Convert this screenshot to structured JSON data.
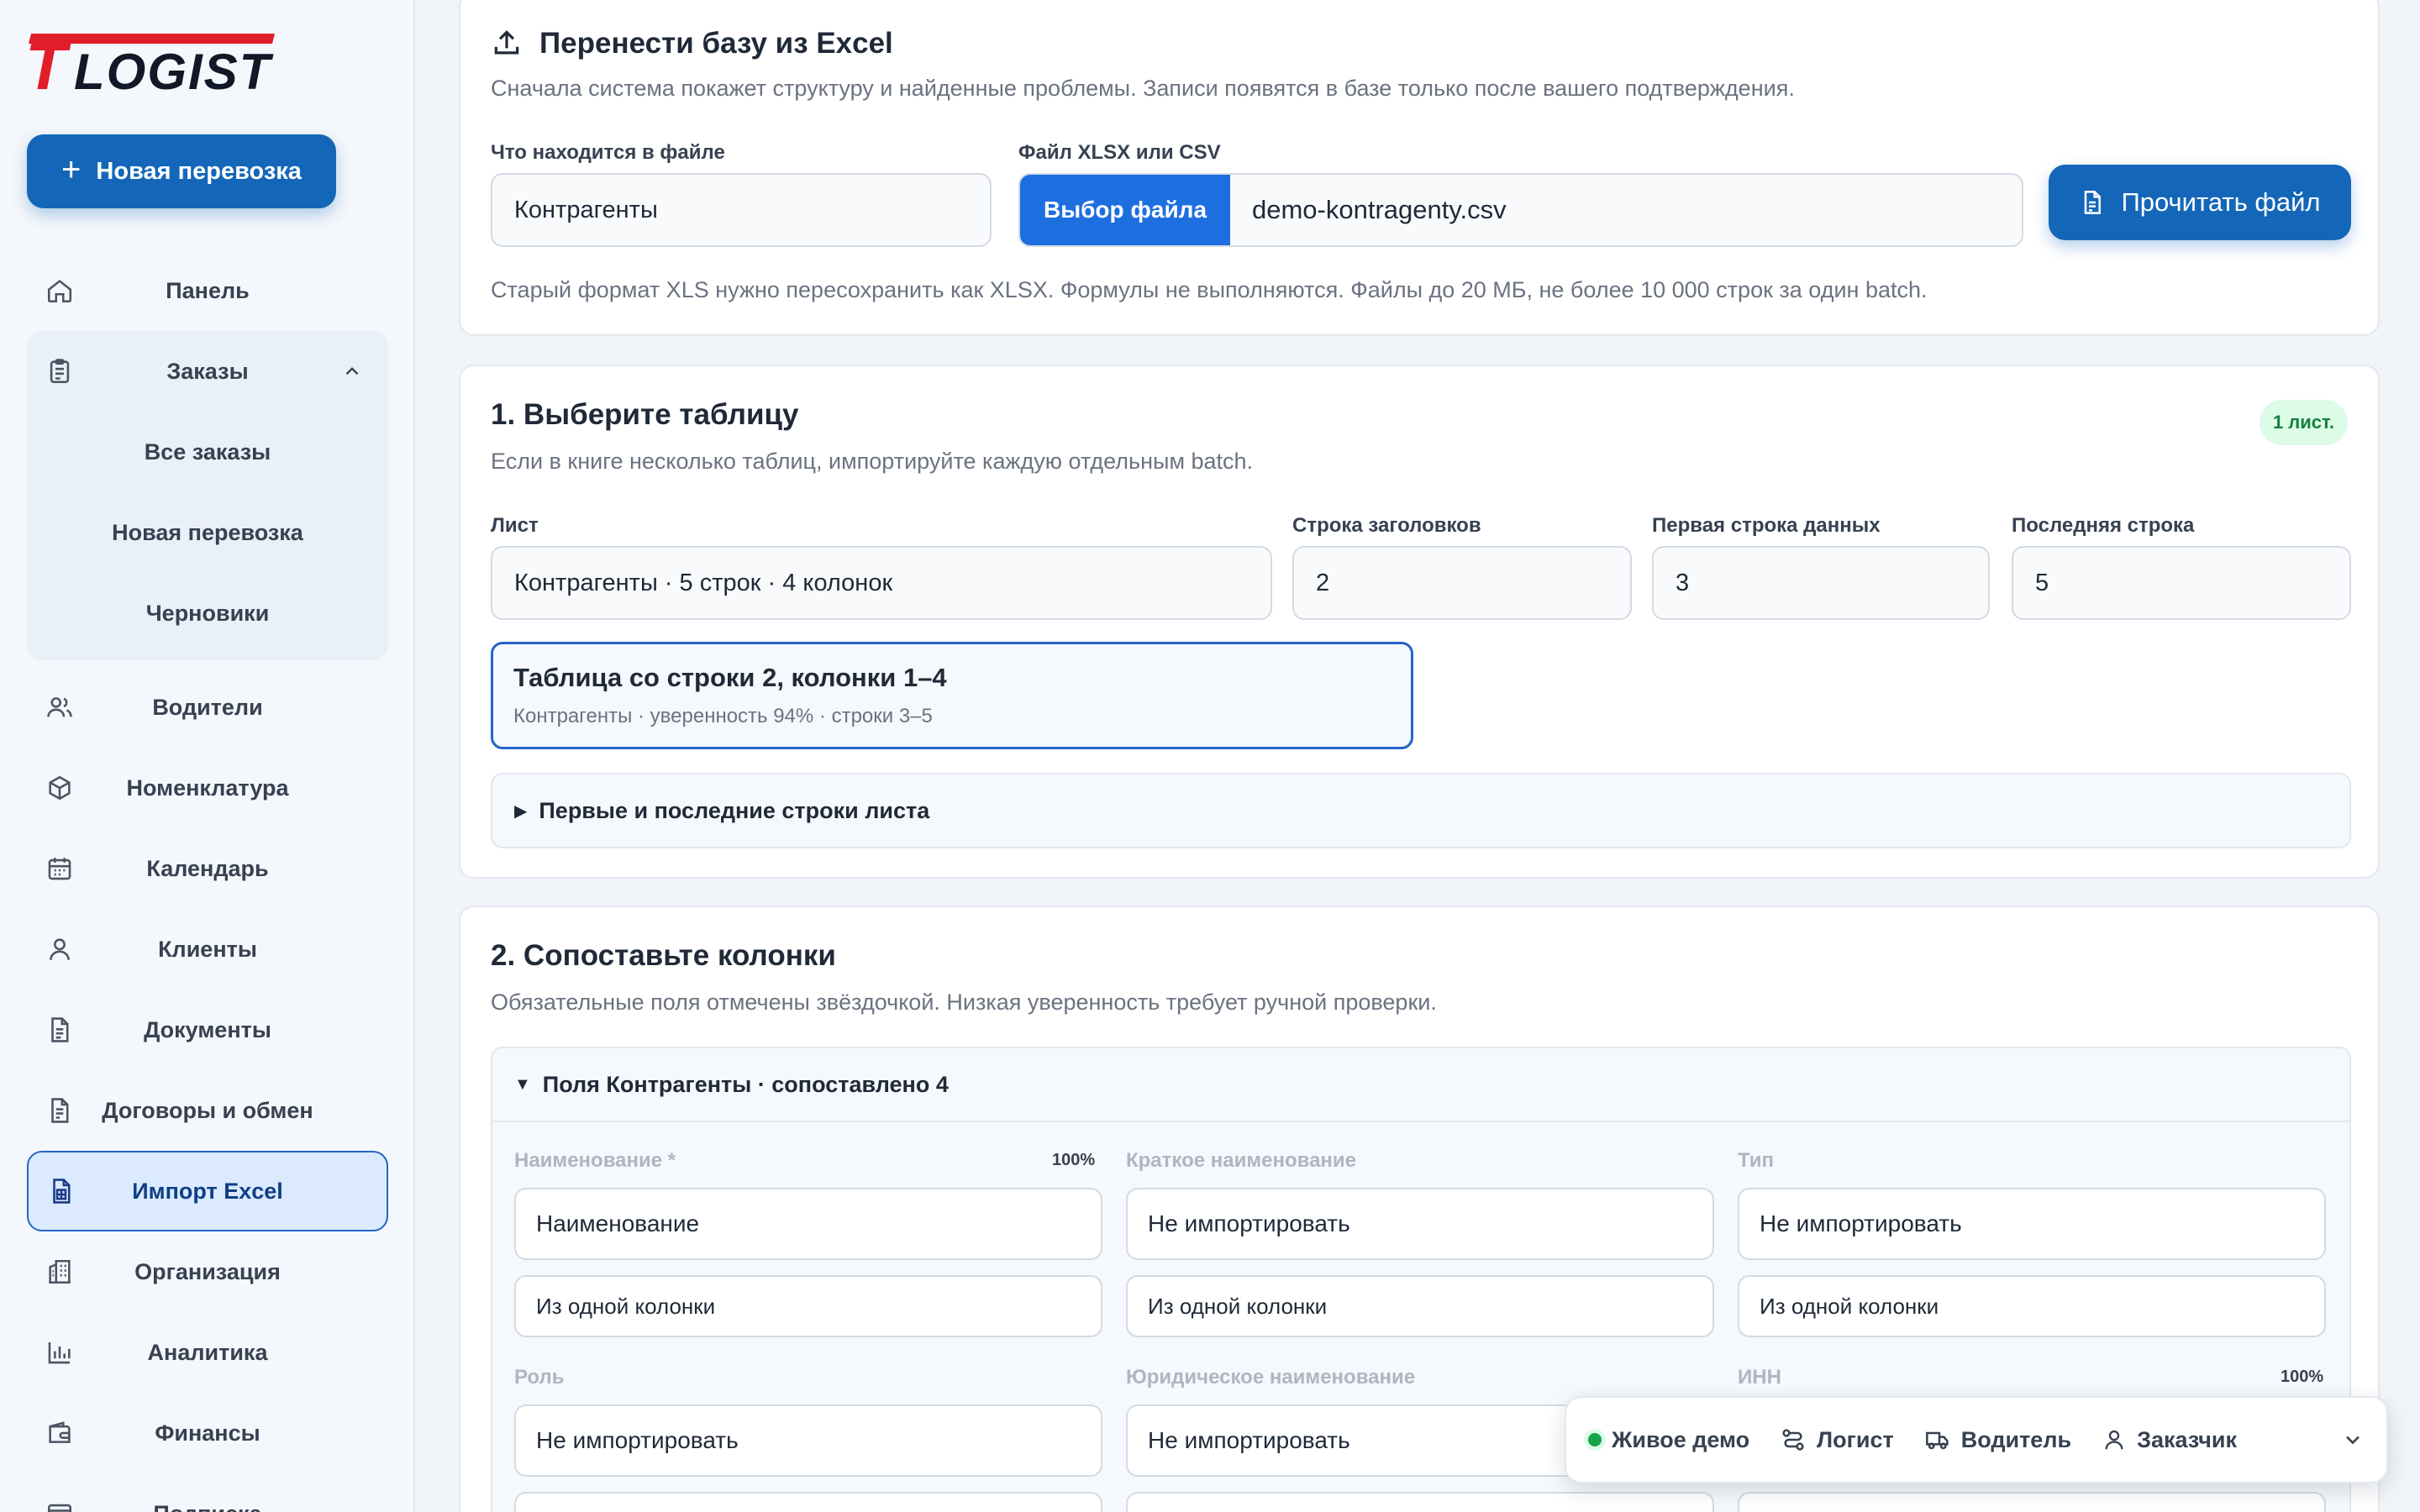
{
  "brand": {
    "logo_text": "TLOGIST",
    "accent": "#e11d2a"
  },
  "sidebar": {
    "new_button": "Новая перевозка",
    "items": [
      {
        "label": "Панель",
        "icon": "home-icon"
      },
      {
        "label": "Заказы",
        "icon": "clipboard-icon",
        "expanded": true,
        "children": [
          "Все заказы",
          "Новая перевозка",
          "Черновики"
        ]
      },
      {
        "label": "Водители",
        "icon": "users-icon"
      },
      {
        "label": "Номенклатура",
        "icon": "package-icon"
      },
      {
        "label": "Календарь",
        "icon": "calendar-icon"
      },
      {
        "label": "Клиенты",
        "icon": "user-icon"
      },
      {
        "label": "Документы",
        "icon": "document-icon"
      },
      {
        "label": "Договоры и обмен",
        "icon": "contract-icon"
      },
      {
        "label": "Импорт Excel",
        "icon": "spreadsheet-icon",
        "active": true
      },
      {
        "label": "Организация",
        "icon": "building-icon"
      },
      {
        "label": "Аналитика",
        "icon": "chart-icon"
      },
      {
        "label": "Финансы",
        "icon": "wallet-icon"
      },
      {
        "label": "Подписка",
        "icon": "card-icon"
      }
    ]
  },
  "upload": {
    "title": "Перенести базу из Excel",
    "subtitle": "Сначала система покажет структуру и найденные проблемы. Записи появятся в базе только после вашего подтверждения.",
    "content_label": "Что находится в файле",
    "content_value": "Контрагенты",
    "file_label": "Файл XLSX или CSV",
    "file_button": "Выбор файла",
    "file_name": "demo-kontragenty.csv",
    "read_button": "Прочитать файл",
    "hint": "Старый формат XLS нужно пересохранить как XLSX. Формулы не выполняются. Файлы до 20 МБ, не более 10 000 строк за один batch."
  },
  "step1": {
    "title": "1. Выберите таблицу",
    "subtitle": "Если в книге несколько таблиц, импортируйте каждую отдельным batch.",
    "badge": "1 лист.",
    "sheet_label": "Лист",
    "sheet_value": "Контрагенты · 5 строк · 4 колонок",
    "header_row_label": "Строка заголовков",
    "header_row_value": "2",
    "first_row_label": "Первая строка данных",
    "first_row_value": "3",
    "last_row_label": "Последняя строка",
    "last_row_value": "5",
    "table_title": "Таблица со строки 2, колонки 1–4",
    "table_sub": "Контрагенты · уверенность 94% · строки 3–5",
    "preview_toggle": "Первые и последние строки листа"
  },
  "step2": {
    "title": "2. Сопоставьте колонки",
    "subtitle": "Обязательные поля отмечены звёздочкой. Низкая уверенность требует ручной проверки.",
    "panel_title": "Поля Контрагенты · сопоставлено 4",
    "fields": [
      {
        "label": "Наименование *",
        "pct": "100%",
        "value": "Наименование",
        "mode": "Из одной колонки"
      },
      {
        "label": "Краткое наименование",
        "pct": "",
        "value": "Не импортировать",
        "mode": "Из одной колонки"
      },
      {
        "label": "Тип",
        "pct": "",
        "value": "Не импортировать",
        "mode": "Из одной колонки"
      },
      {
        "label": "Роль",
        "pct": "",
        "value": "Не импортировать",
        "mode": ""
      },
      {
        "label": "Юридическое наименование",
        "pct": "",
        "value": "Не импортировать",
        "mode": ""
      },
      {
        "label": "ИНН",
        "pct": "100%",
        "value": "",
        "mode": ""
      }
    ]
  },
  "demo_bar": {
    "live": "Живое демо",
    "roles": [
      "Логист",
      "Водитель",
      "Заказчик"
    ]
  }
}
